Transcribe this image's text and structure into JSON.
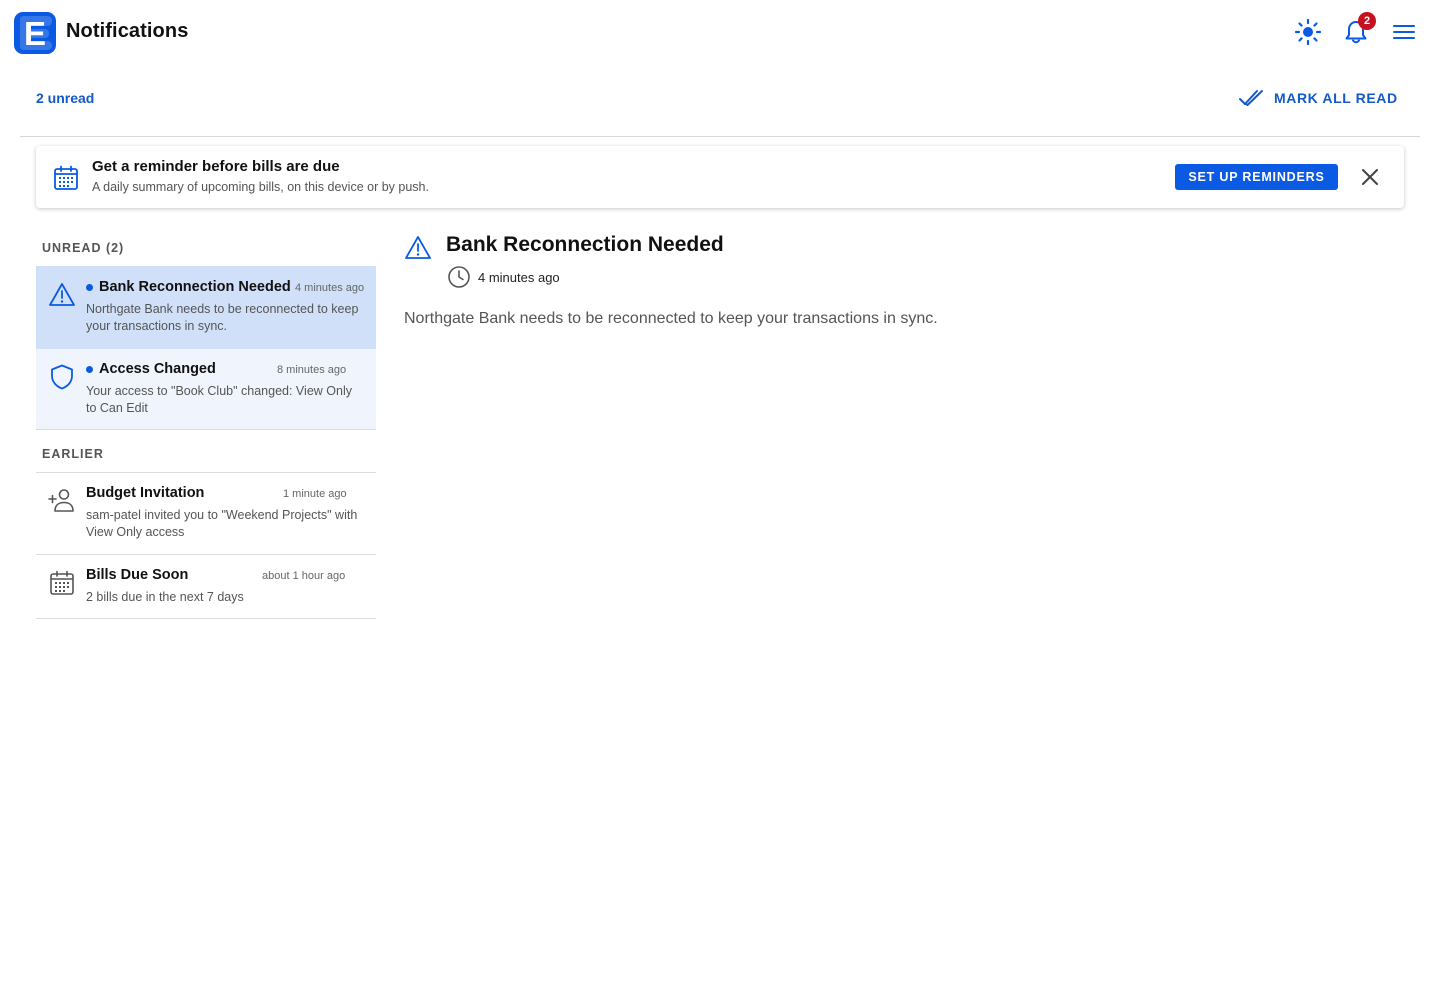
{
  "header": {
    "title": "Notifications",
    "logo_letter": "E",
    "theme_icon": "sun-icon",
    "bell_icon": "bell-icon",
    "bell_badge": "2",
    "menu_icon": "hamburger-menu-icon"
  },
  "toolbar": {
    "unread_label": "2 unread",
    "mark_all_label": "MARK ALL READ",
    "mark_all_icon": "double-check-icon"
  },
  "banner": {
    "icon": "calendar-icon",
    "title": "Get a reminder before bills are due",
    "subtitle": "A daily summary of upcoming bills, on this device or by push.",
    "cta_label": "SET UP REMINDERS",
    "close_icon": "close-icon"
  },
  "list": {
    "unread_header": "UNREAD (2)",
    "earlier_header": "EARLIER",
    "unread_items": [
      {
        "icon": "warning-icon",
        "title": "Bank Reconnection Needed",
        "time": "4 minutes ago",
        "body": "Northgate Bank needs to be reconnected to keep your transactions in sync.",
        "selected": true,
        "unread": true
      },
      {
        "icon": "shield-icon",
        "title": "Access Changed",
        "time": "8 minutes ago",
        "body": "Your access to \"Book Club\" changed: View Only to Can Edit",
        "selected": false,
        "unread": true
      }
    ],
    "earlier_items": [
      {
        "icon": "add-person-icon",
        "title": "Budget Invitation",
        "time": "1 minute ago",
        "body": "sam-patel invited you to \"Weekend Projects\" with View Only access"
      },
      {
        "icon": "calendar-icon",
        "title": "Bills Due Soon",
        "time": "about 1 hour ago",
        "body": "2 bills due in the next 7 days"
      }
    ]
  },
  "detail": {
    "icon": "warning-icon",
    "title": "Bank Reconnection Needed",
    "time_icon": "clock-icon",
    "time": "4 minutes ago",
    "body": "Northgate Bank needs to be reconnected to keep your transactions in sync."
  },
  "colors": {
    "accent": "#0a5ae3",
    "link": "#1259c9",
    "badge": "#c6111e",
    "selected_bg": "#cfe0f8",
    "unread_bg": "#f0f5fd"
  }
}
